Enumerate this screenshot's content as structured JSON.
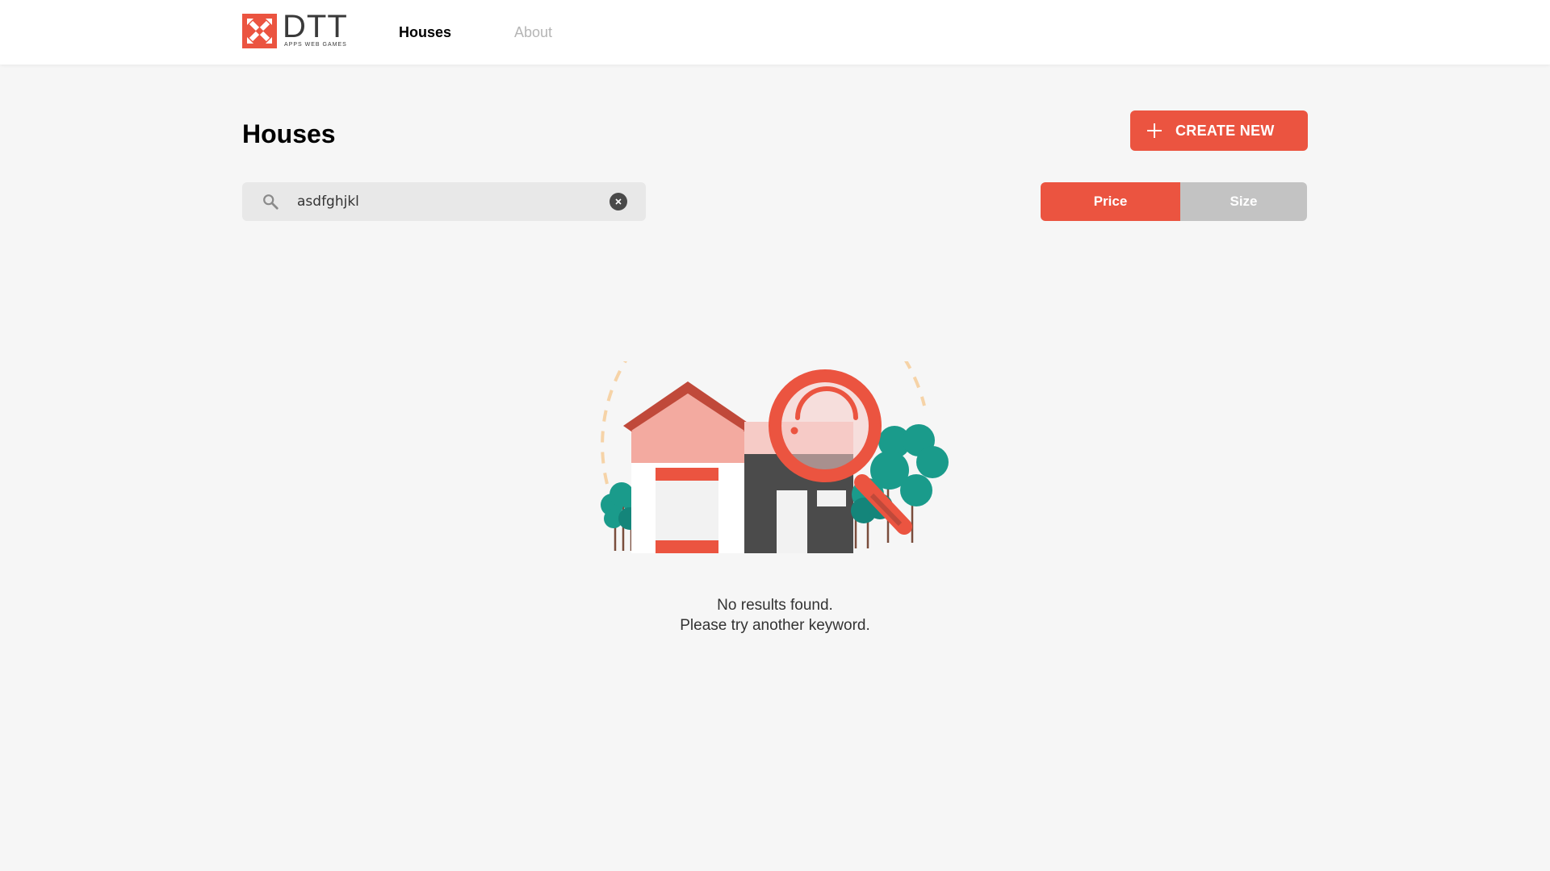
{
  "header": {
    "logo": {
      "brand": "DTT",
      "tagline": "APPS WEB GAMES"
    },
    "nav": [
      {
        "label": "Houses",
        "active": true
      },
      {
        "label": "About",
        "active": false
      }
    ]
  },
  "main": {
    "title": "Houses",
    "create_button": {
      "label": "CREATE NEW",
      "icon": "plus-icon"
    },
    "search": {
      "value": "asdfghjkl",
      "icon": "search-icon",
      "clear_icon": "close-icon"
    },
    "sort": {
      "options": [
        "Price",
        "Size"
      ],
      "selected": "Price"
    },
    "empty_state": {
      "illustration": "house-magnifier-illustration",
      "line1": "No results found.",
      "line2": "Please try another keyword."
    }
  },
  "colors": {
    "accent": "#eb5440",
    "page_background": "#f6f6f6",
    "header_background": "#ffffff",
    "search_background": "#e8e8e8",
    "inactive_toggle": "#c3c3c3",
    "tree_green": "#1a9b8b"
  }
}
